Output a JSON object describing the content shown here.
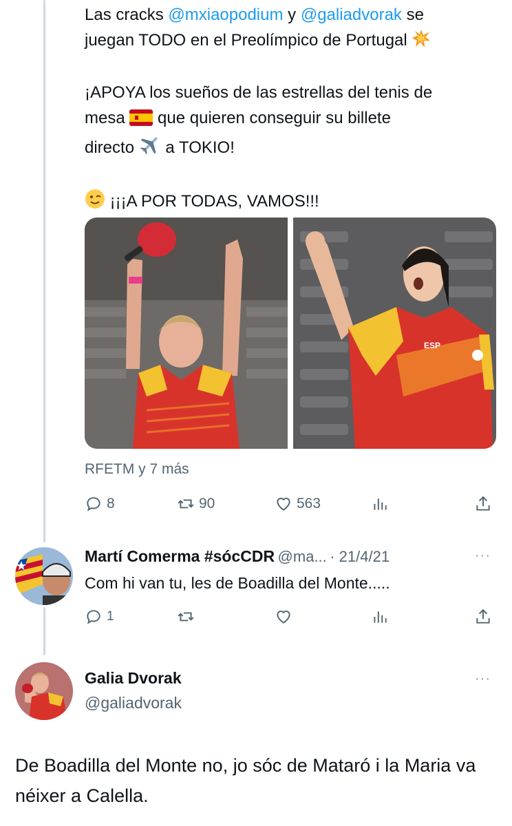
{
  "tweet": {
    "text": {
      "line1_prefix": "Las cracks ",
      "mention1": "@mxiaopodium",
      "line1_mid": " y ",
      "mention2": "@galiadvorak",
      "line1_suffix": " se",
      "line2": "juegan TODO en el Preolímpico de Portugal",
      "line3": "¡APOYA los sueños de las estrellas del tenis de",
      "line4_a": "mesa",
      "line4_b": "que quieren conseguir su billete",
      "line5_a": "directo",
      "line5_b": "a TOKIO!",
      "line6": "¡¡¡A POR TODAS, VAMOS!!!"
    },
    "tagged": "RFETM y 7 más",
    "stats": {
      "replies": "8",
      "retweets": "90",
      "likes": "563"
    }
  },
  "reply": {
    "name": "Martí Comerma #sócCDR",
    "handle": "@ma...",
    "date": "· 21/4/21",
    "text": "Com hi van tu, les de Boadilla del Monte.....",
    "stats": {
      "replies": "1"
    },
    "more": "···"
  },
  "main_tweet": {
    "name": "Galia Dvorak",
    "handle": "@galiadvorak",
    "text": "De Boadilla del Monte no, jo sóc de Mataró i la Maria va néixer a Calella.",
    "more": "···"
  },
  "colors": {
    "accent": "#1d9bf0",
    "muted": "#536471",
    "thread": "#cfd9de"
  },
  "icons": [
    "reply-icon",
    "retweet-icon",
    "like-icon",
    "views-icon",
    "share-icon",
    "more-icon",
    "collision-emoji",
    "spain-flag-emoji",
    "airplane-emoji",
    "wink-emoji"
  ]
}
